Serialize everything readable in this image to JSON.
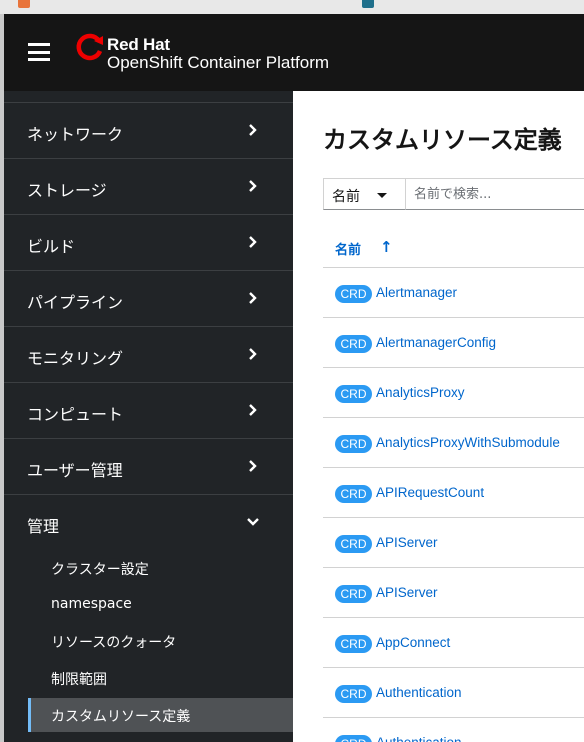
{
  "brand": {
    "top": "Red Hat",
    "bottom": "OpenShift Container Platform"
  },
  "sidebar": {
    "items": [
      {
        "label": "ネットワーク",
        "expanded": false
      },
      {
        "label": "ストレージ",
        "expanded": false
      },
      {
        "label": "ビルド",
        "expanded": false
      },
      {
        "label": "パイプライン",
        "expanded": false
      },
      {
        "label": "モニタリング",
        "expanded": false
      },
      {
        "label": "コンピュート",
        "expanded": false
      },
      {
        "label": "ユーザー管理",
        "expanded": false
      },
      {
        "label": "管理",
        "expanded": true
      }
    ],
    "subitems": [
      {
        "label": "クラスター設定",
        "active": false
      },
      {
        "label": "namespace",
        "active": false
      },
      {
        "label": "リソースのクォータ",
        "active": false
      },
      {
        "label": "制限範囲",
        "active": false
      },
      {
        "label": "カスタムリソース定義",
        "active": true
      }
    ]
  },
  "main": {
    "title": "カスタムリソース定義",
    "filter": {
      "selected": "名前",
      "placeholder": "名前で検索..."
    },
    "table": {
      "column": "名前",
      "sort_icon": "↑",
      "badge": "CRD",
      "rows": [
        "Alertmanager",
        "AlertmanagerConfig",
        "AnalyticsProxy",
        "AnalyticsProxyWithSubmodule",
        "APIRequestCount",
        "APIServer",
        "APIServer",
        "AppConnect",
        "Authentication",
        "Authentication"
      ]
    }
  },
  "colors": {
    "masthead": "#151515",
    "sidebar": "#212427",
    "link": "#0066cc",
    "badge": "#2b9af3",
    "brand_red": "#ee0000"
  }
}
